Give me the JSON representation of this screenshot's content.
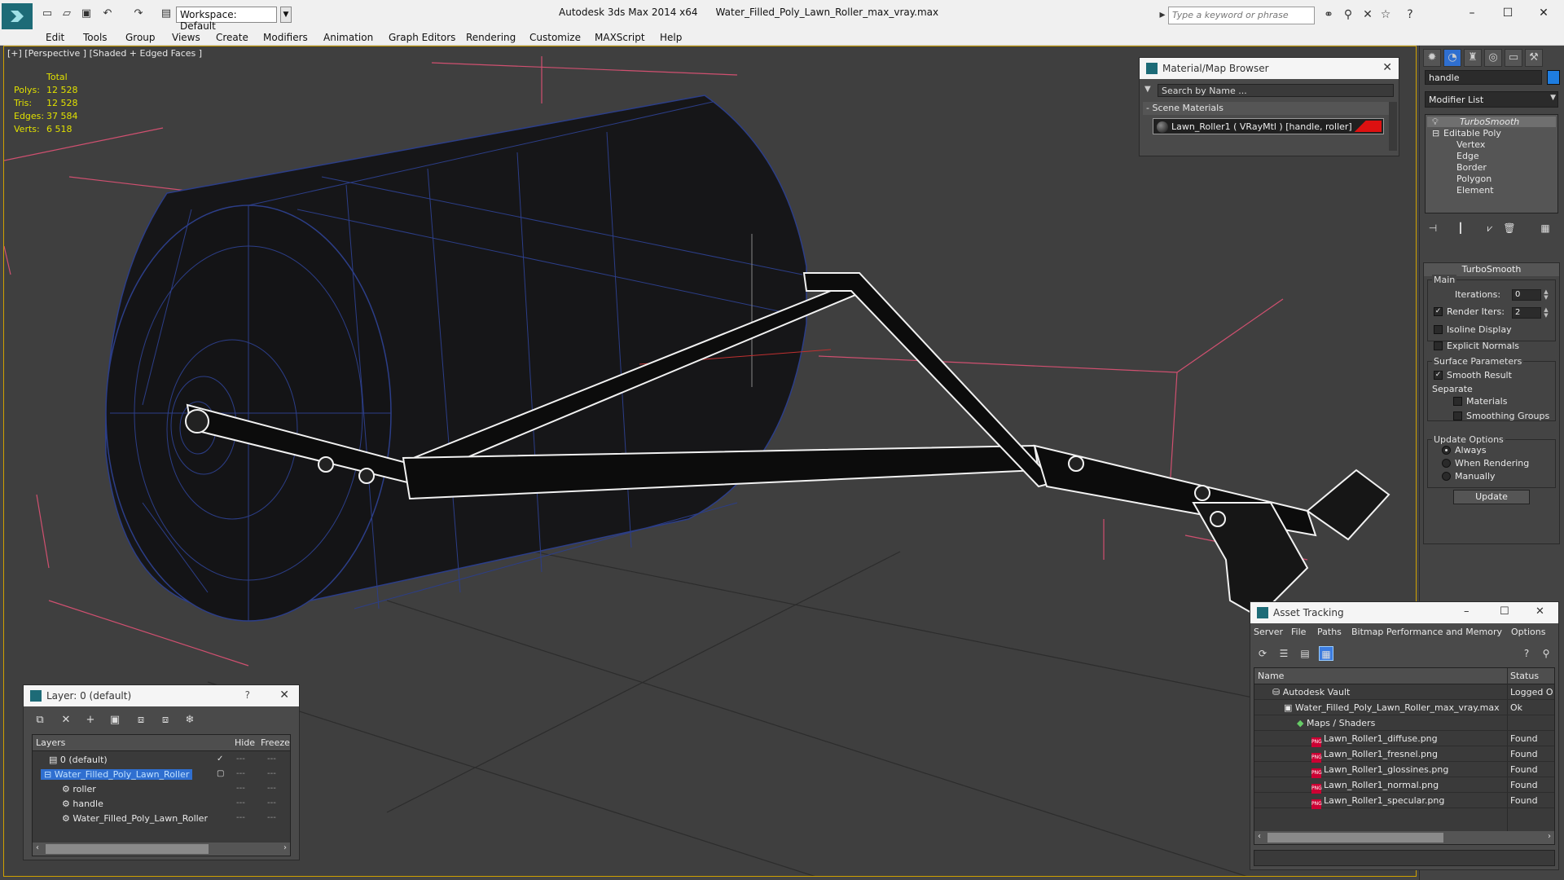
{
  "titlebar": {
    "workspace": "Workspace: Default",
    "app_title": "Autodesk 3ds Max  2014 x64",
    "file_name": "Water_Filled_Poly_Lawn_Roller_max_vray.max",
    "search_placeholder": "Type a keyword or phrase"
  },
  "menu": [
    "Edit",
    "Tools",
    "Group",
    "Views",
    "Create",
    "Modifiers",
    "Animation",
    "Graph Editors",
    "Rendering",
    "Customize",
    "MAXScript",
    "Help"
  ],
  "viewport": {
    "label": "[+] [Perspective ] [Shaded + Edged Faces ]",
    "stats_header": "Total",
    "stats": [
      {
        "key": "Polys:",
        "value": "12 528"
      },
      {
        "key": "Tris:",
        "value": "12 528"
      },
      {
        "key": "Edges:",
        "value": "37 584"
      },
      {
        "key": "Verts:",
        "value": "6 518"
      }
    ]
  },
  "command_panel": {
    "object_name": "handle",
    "object_color": "#1e7de0",
    "modifier_list": "Modifier List",
    "stack": [
      "TurboSmooth",
      "Editable Poly",
      "Vertex",
      "Edge",
      "Border",
      "Polygon",
      "Element"
    ],
    "rollout_title": "TurboSmooth",
    "main_label": "Main",
    "iterations_label": "Iterations:",
    "iterations_value": "0",
    "render_iters_label": "Render Iters:",
    "render_iters_value": "2",
    "isoline_label": "Isoline Display",
    "explicit_normals_label": "Explicit Normals",
    "surface_params_label": "Surface Parameters",
    "smooth_result_label": "Smooth Result",
    "separate_label": "Separate",
    "materials_label": "Materials",
    "smoothing_groups_label": "Smoothing Groups",
    "update_options_label": "Update Options",
    "always_label": "Always",
    "when_rendering_label": "When Rendering",
    "manually_label": "Manually",
    "update_button": "Update"
  },
  "material_browser": {
    "title": "Material/Map Browser",
    "search_placeholder": "Search by Name ...",
    "section": "Scene Materials",
    "item": "Lawn_Roller1  ( VRayMtl )  [handle, roller]"
  },
  "layer_dialog": {
    "title": "Layer: 0 (default)",
    "help": "?",
    "col_layers": "Layers",
    "col_hide": "Hide",
    "col_freeze": "Freeze",
    "rows": [
      {
        "name": "0 (default)"
      },
      {
        "name": "Water_Filled_Poly_Lawn_Roller"
      },
      {
        "name": "roller"
      },
      {
        "name": "handle"
      },
      {
        "name": "Water_Filled_Poly_Lawn_Roller"
      }
    ]
  },
  "asset_tracking": {
    "title": "Asset Tracking",
    "menu": [
      "Server",
      "File",
      "Paths",
      "Bitmap Performance and Memory",
      "Options"
    ],
    "col_name": "Name",
    "col_status": "Status",
    "rows": [
      {
        "name": "Autodesk Vault",
        "status": "Logged O"
      },
      {
        "name": "Water_Filled_Poly_Lawn_Roller_max_vray.max",
        "status": "Ok"
      },
      {
        "name": "Maps / Shaders",
        "status": ""
      },
      {
        "name": "Lawn_Roller1_diffuse.png",
        "status": "Found"
      },
      {
        "name": "Lawn_Roller1_fresnel.png",
        "status": "Found"
      },
      {
        "name": "Lawn_Roller1_glossines.png",
        "status": "Found"
      },
      {
        "name": "Lawn_Roller1_normal.png",
        "status": "Found"
      },
      {
        "name": "Lawn_Roller1_specular.png",
        "status": "Found"
      }
    ]
  }
}
